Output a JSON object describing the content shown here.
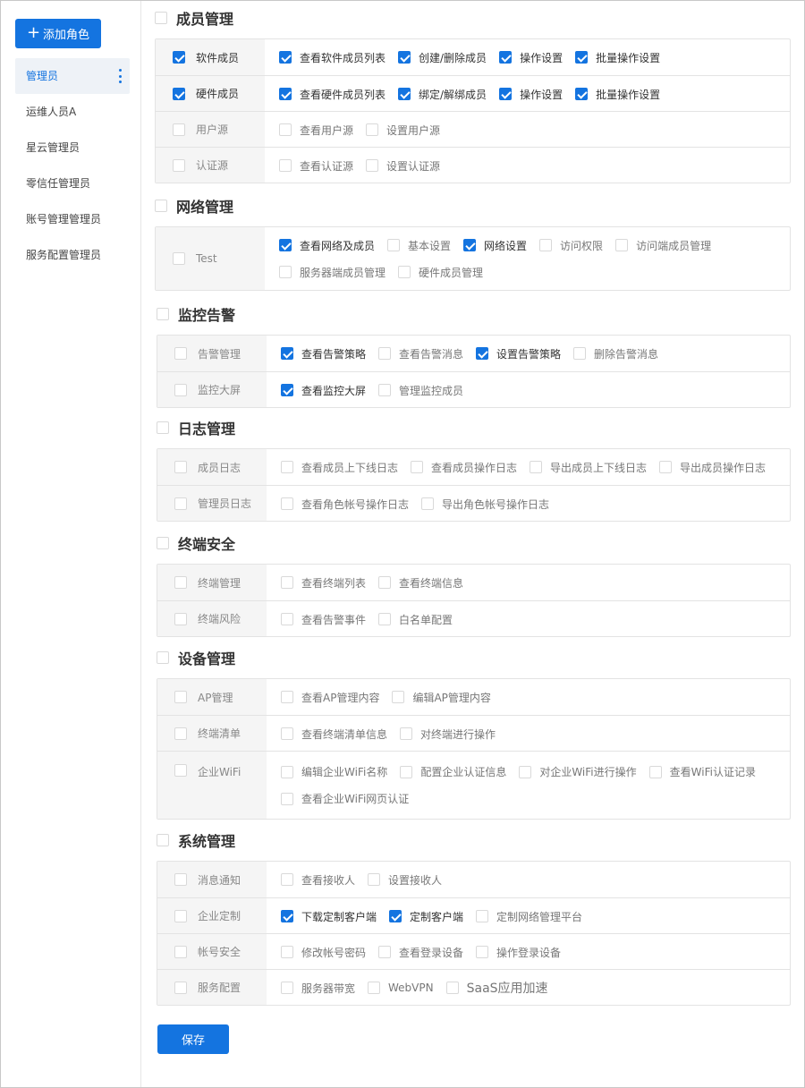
{
  "sidebar": {
    "add_label": "添加角色",
    "roles": [
      {
        "label": "管理员",
        "active": true
      },
      {
        "label": "运维人员A"
      },
      {
        "label": "星云管理员"
      },
      {
        "label": "零信任管理员"
      },
      {
        "label": "账号管理管理员"
      },
      {
        "label": "服务配置管理员"
      }
    ]
  },
  "sections": [
    {
      "title": "成员管理",
      "rows": [
        {
          "label": "软件成员",
          "checked": true,
          "perms": [
            {
              "label": "查看软件成员列表",
              "checked": true
            },
            {
              "label": "创建/删除成员",
              "checked": true
            },
            {
              "label": "操作设置",
              "checked": true
            },
            {
              "label": "批量操作设置",
              "checked": true
            }
          ]
        },
        {
          "label": "硬件成员",
          "checked": true,
          "perms": [
            {
              "label": "查看硬件成员列表",
              "checked": true
            },
            {
              "label": "绑定/解绑成员",
              "checked": true
            },
            {
              "label": "操作设置",
              "checked": true
            },
            {
              "label": "批量操作设置",
              "checked": true
            }
          ]
        },
        {
          "label": "用户源",
          "checked": false,
          "perms": [
            {
              "label": "查看用户源",
              "checked": false
            },
            {
              "label": "设置用户源",
              "checked": false
            }
          ]
        },
        {
          "label": "认证源",
          "checked": false,
          "perms": [
            {
              "label": "查看认证源",
              "checked": false
            },
            {
              "label": "设置认证源",
              "checked": false
            }
          ]
        }
      ]
    },
    {
      "title": "网络管理",
      "rows": [
        {
          "label": "Test",
          "checked": false,
          "perms": [
            {
              "label": "查看网络及成员",
              "checked": true
            },
            {
              "label": "基本设置",
              "checked": false
            },
            {
              "label": "网络设置",
              "checked": true
            },
            {
              "label": "访问权限",
              "checked": false
            },
            {
              "label": "访问端成员管理",
              "checked": false
            },
            {
              "label": "服务器端成员管理",
              "checked": false
            },
            {
              "label": "硬件成员管理",
              "checked": false
            }
          ]
        }
      ]
    },
    {
      "title": "监控告警",
      "rows": [
        {
          "label": "告警管理",
          "checked": false,
          "perms": [
            {
              "label": "查看告警策略",
              "checked": true
            },
            {
              "label": "查看告警消息",
              "checked": false
            },
            {
              "label": "设置告警策略",
              "checked": true
            },
            {
              "label": "删除告警消息",
              "checked": false
            }
          ]
        },
        {
          "label": "监控大屏",
          "checked": false,
          "perms": [
            {
              "label": "查看监控大屏",
              "checked": true
            },
            {
              "label": "管理监控成员",
              "checked": false
            }
          ]
        }
      ]
    },
    {
      "title": "日志管理",
      "rows": [
        {
          "label": "成员日志",
          "checked": false,
          "perms": [
            {
              "label": "查看成员上下线日志",
              "checked": false
            },
            {
              "label": "查看成员操作日志",
              "checked": false
            },
            {
              "label": "导出成员上下线日志",
              "checked": false
            },
            {
              "label": "导出成员操作日志",
              "checked": false
            }
          ]
        },
        {
          "label": "管理员日志",
          "checked": false,
          "perms": [
            {
              "label": "查看角色帐号操作日志",
              "checked": false
            },
            {
              "label": "导出角色帐号操作日志",
              "checked": false
            }
          ]
        }
      ]
    },
    {
      "title": "终端安全",
      "rows": [
        {
          "label": "终端管理",
          "checked": false,
          "perms": [
            {
              "label": "查看终端列表",
              "checked": false
            },
            {
              "label": "查看终端信息",
              "checked": false
            }
          ]
        },
        {
          "label": "终端风险",
          "checked": false,
          "perms": [
            {
              "label": "查看告警事件",
              "checked": false
            },
            {
              "label": "白名单配置",
              "checked": false
            }
          ]
        }
      ]
    },
    {
      "title": "设备管理",
      "rows": [
        {
          "label": "AP管理",
          "checked": false,
          "perms": [
            {
              "label": "查看AP管理内容",
              "checked": false
            },
            {
              "label": "编辑AP管理内容",
              "checked": false
            }
          ]
        },
        {
          "label": "终端清单",
          "checked": false,
          "perms": [
            {
              "label": "查看终端清单信息",
              "checked": false
            },
            {
              "label": "对终端进行操作",
              "checked": false
            }
          ]
        },
        {
          "label": "企业WiFi",
          "checked": false,
          "perms": [
            {
              "label": "编辑企业WiFi名称",
              "checked": false
            },
            {
              "label": "配置企业认证信息",
              "checked": false
            },
            {
              "label": "对企业WiFi进行操作",
              "checked": false
            },
            {
              "label": "查看WiFi认证记录",
              "checked": false
            },
            {
              "label": "查看企业WiFi网页认证",
              "checked": false
            }
          ]
        }
      ]
    },
    {
      "title": "系统管理",
      "rows": [
        {
          "label": "消息通知",
          "checked": false,
          "perms": [
            {
              "label": "查看接收人",
              "checked": false
            },
            {
              "label": "设置接收人",
              "checked": false
            }
          ]
        },
        {
          "label": "企业定制",
          "checked": false,
          "perms": [
            {
              "label": "下载定制客户端",
              "checked": true
            },
            {
              "label": "定制客户端",
              "checked": true
            },
            {
              "label": "定制网络管理平台",
              "checked": false
            }
          ]
        },
        {
          "label": "帐号安全",
          "checked": false,
          "perms": [
            {
              "label": "修改帐号密码",
              "checked": false
            },
            {
              "label": "查看登录设备",
              "checked": false
            },
            {
              "label": "操作登录设备",
              "checked": false
            }
          ]
        },
        {
          "label": "服务配置",
          "checked": false,
          "perms": [
            {
              "label": "服务器带宽",
              "checked": false
            },
            {
              "label": "WebVPN",
              "checked": false
            },
            {
              "label": "SaaS应用加速",
              "checked": false
            }
          ]
        }
      ]
    }
  ],
  "save_label": "保存",
  "colors": {
    "accent": "#1474e0",
    "label_bg": "#f5f5f5",
    "border": "#e3e3e3"
  }
}
